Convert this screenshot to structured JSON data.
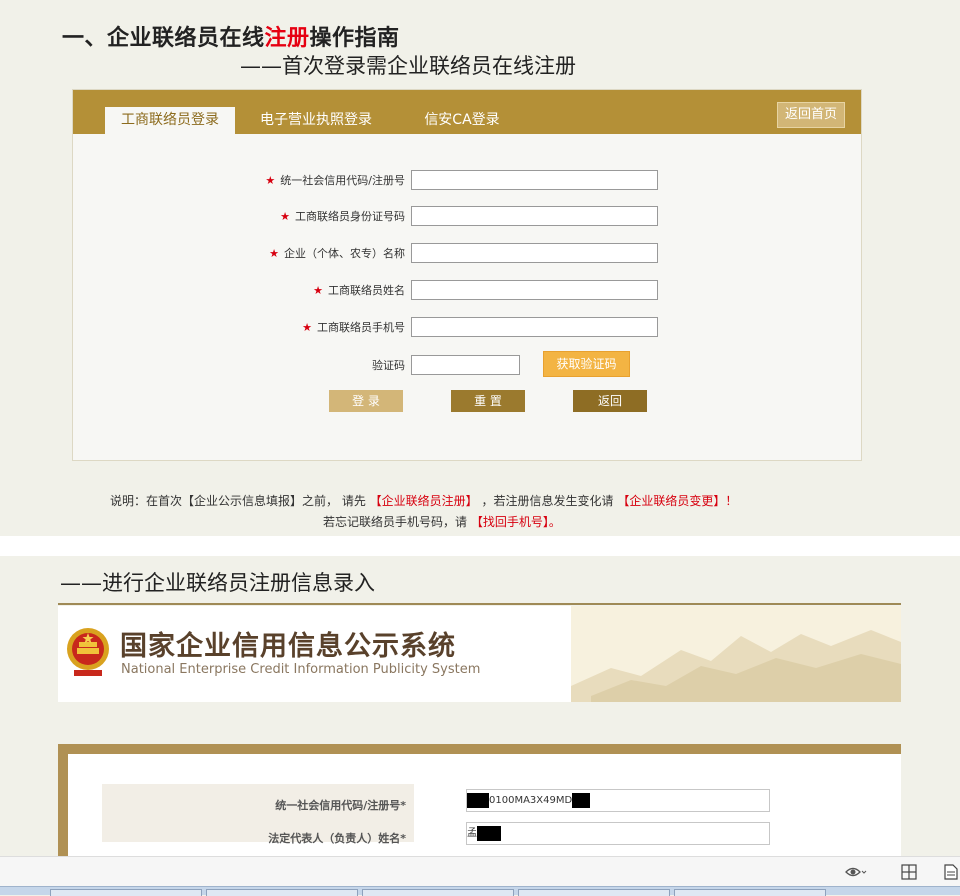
{
  "heading": {
    "prefix": "一、企业联络员在线",
    "highlight": "注册",
    "suffix": "操作指南",
    "subtitle": "——首次登录需企业联络员在线注册"
  },
  "login_panel": {
    "tabs": [
      {
        "label": "工商联络员登录",
        "active": true
      },
      {
        "label": "电子营业执照登录",
        "active": false
      },
      {
        "label": "信安CA登录",
        "active": false
      }
    ],
    "home_button": "返回首页",
    "required_mark": "★",
    "fields": [
      {
        "label": "统一社会信用代码/注册号",
        "value": "",
        "required": true
      },
      {
        "label": "工商联络员身份证号码",
        "value": "",
        "required": true
      },
      {
        "label": "企业（个体、农专）名称",
        "value": "",
        "required": true
      },
      {
        "label": "工商联络员姓名",
        "value": "",
        "required": true
      },
      {
        "label": "工商联络员手机号",
        "value": "",
        "required": true
      }
    ],
    "captcha": {
      "label": "验证码",
      "value": "",
      "button": "获取验证码"
    },
    "buttons": {
      "login": "登 录",
      "reset": "重 置",
      "back": "返回"
    }
  },
  "notes": {
    "line1_a": "说明：在首次【企业公示信息填报】之前，  请先",
    "line1_link1": "【企业联络员注册】",
    "line1_b": "，若注册信息发生变化请",
    "line1_link2": "【企业联络员变更】！",
    "line2_a": "若忘记联络员手机号码，请",
    "line2_link": "【找回手机号】。"
  },
  "section2": {
    "title": "——进行企业联络员注册信息录入"
  },
  "system_banner": {
    "name_cn": "国家企业信用信息公示系统",
    "name_en": "National Enterprise Credit Information Publicity System"
  },
  "registration_form": {
    "fields": [
      {
        "label": "统一社会信用代码/注册号*",
        "value": "0100MA3X49MD"
      },
      {
        "label": "法定代表人（负责人）姓名*",
        "value": "孟"
      }
    ]
  },
  "colors": {
    "accent_gold": "#b49037",
    "required_red": "#d7000f",
    "title_highlight": "#e60012"
  }
}
